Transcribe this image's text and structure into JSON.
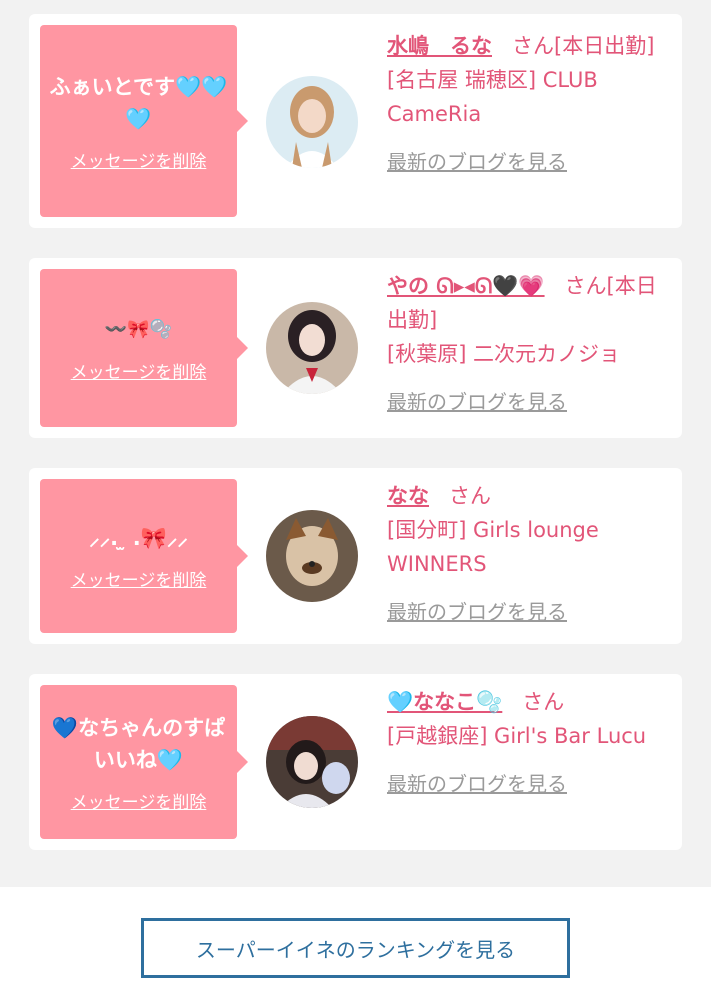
{
  "cards": [
    {
      "message": "ふぁいとです🩵🩵🩵",
      "delete_label": "メッセージを削除",
      "name": "水嶋　るな",
      "suffix": "さん[本日出勤]",
      "shop": "[名古屋 瑞穂区] CLUB CameRia",
      "blog_label": "最新のブログを見る"
    },
    {
      "message": "〰️🎀🫧",
      "delete_label": "メッセージを削除",
      "name": "やの ᘏ▸◂ᘏ🖤💗",
      "suffix": "さん[本日出勤]",
      "shop": "[秋葉原] 二次元カノジョ",
      "blog_label": "最新のブログを見る"
    },
    {
      "message": "⸝⸝. ̫ .🎀⸝⸝",
      "delete_label": "メッセージを削除",
      "name": "なな",
      "suffix": "さん",
      "shop": "[国分町] Girls lounge WINNERS",
      "blog_label": "最新のブログを見る"
    },
    {
      "message": "💙なちゃんのすぱいいね🩵",
      "delete_label": "メッセージを削除",
      "name": "🩵ななこ🫧",
      "suffix": "さん",
      "shop": "[戸越銀座] Girl's Bar Lucu",
      "blog_label": "最新のブログを見る"
    }
  ],
  "footer": {
    "ranking_button": "スーパーイイネのランキングを見る"
  },
  "colors": {
    "bubble": "#ff96a2",
    "accent_text": "#e25578",
    "link_gray": "#9a9a9a",
    "button_border": "#2e6f9e",
    "background": "#f2f2f2"
  }
}
